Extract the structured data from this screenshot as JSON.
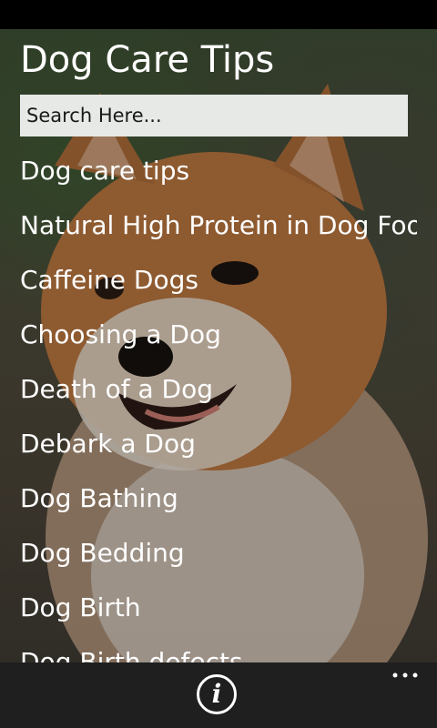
{
  "app": {
    "title": "Dog Care Tips"
  },
  "search": {
    "placeholder": "Search Here..."
  },
  "list": {
    "items": [
      {
        "label": "Dog care tips"
      },
      {
        "label": "Natural High Protein in Dog Food"
      },
      {
        "label": "Caffeine Dogs"
      },
      {
        "label": "Choosing a Dog"
      },
      {
        "label": "Death of a Dog"
      },
      {
        "label": "Debark a Dog"
      },
      {
        "label": "Dog Bathing"
      },
      {
        "label": "Dog Bedding"
      },
      {
        "label": "Dog Birth"
      },
      {
        "label": "Dog Birth defects"
      }
    ]
  },
  "app_bar": {
    "info_icon": "info-icon",
    "more_icon": "more-dots-icon"
  },
  "colors": {
    "app_bar": "#1f1f1f",
    "search_bg": "#e6e9e6",
    "text": "#ffffff"
  }
}
